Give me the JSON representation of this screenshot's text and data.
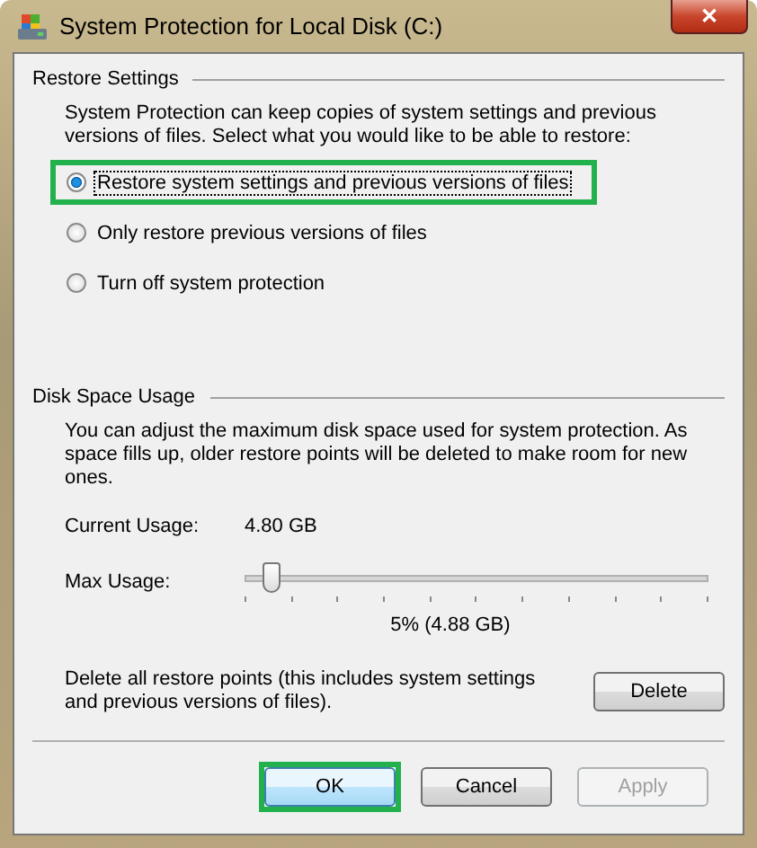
{
  "window": {
    "title": "System Protection for Local Disk (C:)",
    "close": "✕"
  },
  "restore_settings": {
    "title": "Restore Settings",
    "description": "System Protection can keep copies of system settings and previous versions of files. Select what you would like to be able to restore:",
    "options": [
      {
        "label": "Restore system settings and previous versions of files",
        "selected": true,
        "highlighted": true
      },
      {
        "label": "Only restore previous versions of files",
        "selected": false,
        "highlighted": false
      },
      {
        "label": "Turn off system protection",
        "selected": false,
        "highlighted": false
      }
    ]
  },
  "disk_space": {
    "title": "Disk Space Usage",
    "description": "You can adjust the maximum disk space used for system protection. As space fills up, older restore points will be deleted to make room for new ones.",
    "current_usage_label": "Current Usage:",
    "current_usage": "4.80 GB",
    "max_usage_label": "Max Usage:",
    "max_usage": {
      "level": 0.06
    },
    "max_usage_reading": "5% (4.88 GB)",
    "delete_text": "Delete all restore points (this includes system settings and previous versions of files).",
    "delete_button": "Delete"
  },
  "buttons": [
    {
      "label": "OK",
      "highlighted": true,
      "disabled": false
    },
    {
      "label": "Cancel",
      "highlighted": false,
      "disabled": false
    },
    {
      "label": "Apply",
      "highlighted": false,
      "disabled": true
    }
  ]
}
